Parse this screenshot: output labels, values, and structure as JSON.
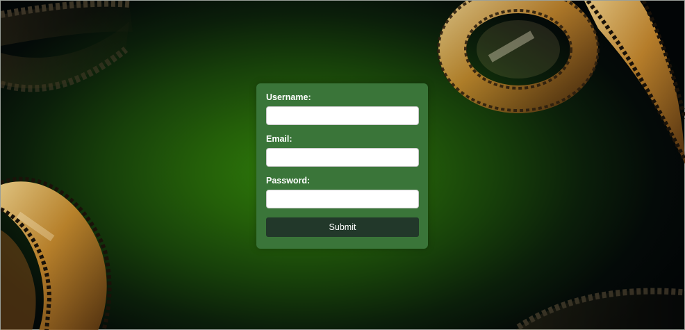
{
  "login_form": {
    "username": {
      "label": "Username:",
      "value": "",
      "placeholder": ""
    },
    "email": {
      "label": "Email:",
      "value": "",
      "placeholder": ""
    },
    "password": {
      "label": "Password:",
      "value": "",
      "placeholder": ""
    },
    "submit_label": "Submit"
  },
  "background": {
    "decoration": "film-strip-reels",
    "colors": {
      "center_glow": "#2f7d0a",
      "edge": "#020506",
      "card": "#3a7539",
      "button": "#22382a",
      "film_gold": "#d9a24a",
      "film_dark": "#2a2a2a"
    }
  }
}
